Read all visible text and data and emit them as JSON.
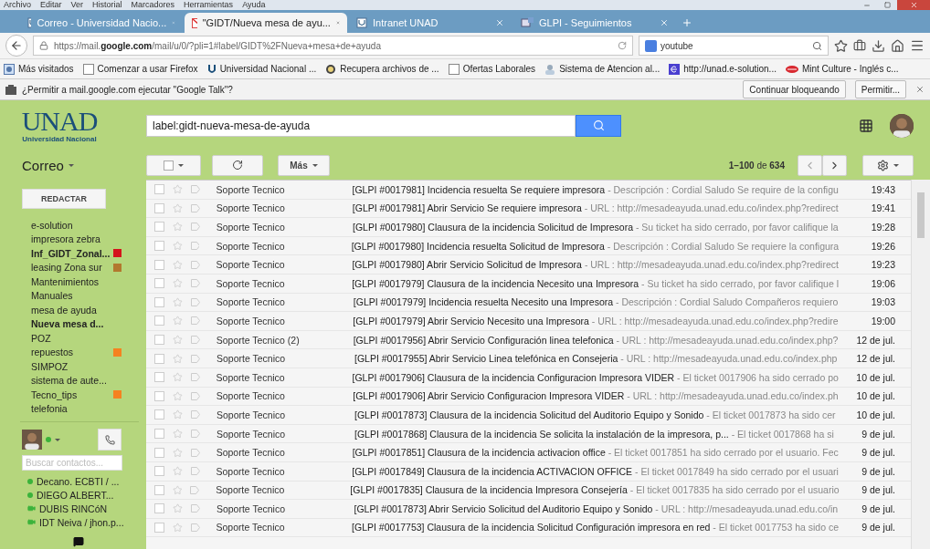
{
  "menu_bar": [
    "Archivo",
    "Editar",
    "Ver",
    "Historial",
    "Marcadores",
    "Herramientas",
    "Ayuda"
  ],
  "tabs": [
    {
      "title": "Correo - Universidad Nacio...",
      "kind": "unad",
      "selected": false
    },
    {
      "title": "\"GIDT/Nueva mesa de ayu...",
      "kind": "gmail",
      "selected": true
    },
    {
      "title": "Intranet UNAD",
      "kind": "unad",
      "selected": false
    },
    {
      "title": "GLPI - Seguimientos",
      "kind": "glpi",
      "selected": false
    }
  ],
  "address_bar": {
    "host_before": "https://mail.",
    "host": "google.com",
    "path": "/mail/u/0/?pli=1#label/GIDT%2FNueva+mesa+de+ayuda"
  },
  "search_bar": {
    "value": "youtube"
  },
  "bookmarks": [
    {
      "label": "Más visitados",
      "kind": "folder"
    },
    {
      "label": "Comenzar a usar Firefox",
      "kind": "blank"
    },
    {
      "label": "Universidad Nacional ...",
      "kind": "unad"
    },
    {
      "label": "Recupera archivos de ...",
      "kind": "badge"
    },
    {
      "label": "Ofertas Laborales",
      "kind": "blank"
    },
    {
      "label": "Sistema de Atencion al...",
      "kind": "person"
    },
    {
      "label": "http://unad.e-solution...",
      "kind": "letter"
    },
    {
      "label": "Mint Culture - Inglés c...",
      "kind": "lips"
    }
  ],
  "notification": {
    "message": "¿Permitir a mail.google.com ejecutar \"Google Talk\"?",
    "buttons": [
      "Continuar bloqueando",
      "Permitir..."
    ]
  },
  "gmail": {
    "logo": {
      "text": "UNAD",
      "caption": "Universidad Nacional"
    },
    "search": {
      "value": "label:gidt-nueva-mesa-de-ayuda"
    },
    "app_title": "Correo",
    "compose": "REDACTAR",
    "more": "Más",
    "pagination": "**1–100** de **634**",
    "labels": [
      {
        "name": "e-solution",
        "unread": false
      },
      {
        "name": "impresora zebra",
        "unread": false
      },
      {
        "name": "Inf_GIDT_Zonal...",
        "unread": true,
        "color": "#d4141c"
      },
      {
        "name": "leasing Zona sur",
        "unread": false,
        "color": "#b2782e"
      },
      {
        "name": "Mantenimientos",
        "unread": false
      },
      {
        "name": "Manuales",
        "unread": false
      },
      {
        "name": "mesa de ayuda",
        "unread": false
      },
      {
        "name": "Nueva mesa d...",
        "unread": true
      },
      {
        "name": "POZ",
        "unread": false
      },
      {
        "name": "repuestos",
        "unread": false,
        "color": "#f58220"
      },
      {
        "name": "SIMPOZ",
        "unread": false
      },
      {
        "name": "sistema de aute...",
        "unread": false
      },
      {
        "name": "Tecno_tips",
        "unread": false,
        "color": "#f58220"
      },
      {
        "name": "telefonia",
        "unread": false
      }
    ],
    "chat": {
      "search_placeholder": "Buscar contactos...",
      "contacts": [
        {
          "name": "Decano. ECBTI / ...",
          "kind": "online"
        },
        {
          "name": "DIEGO ALBERT...",
          "kind": "online"
        },
        {
          "name": "DUBIS RINCóN",
          "kind": "video"
        },
        {
          "name": "IDT Neiva / jhon.p...",
          "kind": "video"
        }
      ]
    },
    "emails": [
      {
        "checked": false,
        "starred": false,
        "sender": "Soporte Tecnico",
        "subject": "[GLPI #0017981] Incidencia resuelta Se requiere impresora",
        "snippet": "- Descripción : Cordial Saludo Se require de la configu",
        "date": "19:43"
      },
      {
        "checked": false,
        "starred": false,
        "sender": "Soporte Tecnico",
        "subject": "[GLPI #0017981] Abrir Servicio Se requiere impresora",
        "snippet": "- URL : http://mesadeayuda.unad.edu.co/index.php?redirect",
        "date": "19:41"
      },
      {
        "checked": false,
        "starred": false,
        "sender": "Soporte Tecnico",
        "subject": "[GLPI #0017980] Clausura de la incidencia Solicitud de Impresora",
        "snippet": "- Su ticket ha sido cerrado, por favor califique la",
        "date": "19:28"
      },
      {
        "checked": false,
        "starred": false,
        "sender": "Soporte Tecnico",
        "subject": "[GLPI #0017980] Incidencia resuelta Solicitud de Impresora",
        "snippet": "- Descripción : Cordial Saludo Se requiere la configura",
        "date": "19:26"
      },
      {
        "checked": false,
        "starred": false,
        "sender": "Soporte Tecnico",
        "subject": "[GLPI #0017980] Abrir Servicio Solicitud de Impresora",
        "snippet": "- URL : http://mesadeayuda.unad.edu.co/index.php?redirect",
        "date": "19:23"
      },
      {
        "checked": false,
        "starred": false,
        "sender": "Soporte Tecnico",
        "subject": "[GLPI #0017979] Clausura de la incidencia Necesito una Impresora",
        "snippet": "- Su ticket ha sido cerrado, por favor califique l",
        "date": "19:06"
      },
      {
        "checked": false,
        "starred": false,
        "sender": "Soporte Tecnico",
        "subject": "[GLPI #0017979] Incidencia resuelta Necesito una Impresora",
        "snippet": "- Descripción : Cordial Saludo Compañeros requiero",
        "date": "19:03"
      },
      {
        "checked": false,
        "starred": false,
        "sender": "Soporte Tecnico",
        "subject": "[GLPI #0017979] Abrir Servicio Necesito una Impresora",
        "snippet": "- URL : http://mesadeayuda.unad.edu.co/index.php?redire",
        "date": "19:00"
      },
      {
        "checked": false,
        "starred": false,
        "sender": "Soporte Tecnico (2)",
        "subject": "[GLPI #0017956] Abrir Servicio Configuración linea telefonica",
        "snippet": "- URL : http://mesadeayuda.unad.edu.co/index.php?",
        "date": "12 de jul."
      },
      {
        "checked": false,
        "starred": false,
        "sender": "Soporte Tecnico",
        "subject": "[GLPI #0017955] Abrir Servicio Linea telefónica en Consejeria",
        "snippet": "- URL : http://mesadeayuda.unad.edu.co/index.php",
        "date": "12 de jul."
      },
      {
        "checked": false,
        "starred": false,
        "sender": "Soporte Tecnico",
        "subject": "[GLPI #0017906] Clausura de la incidencia Configuracion Impresora VIDER",
        "snippet": "- El ticket 0017906 ha sido cerrado po",
        "date": "10 de jul."
      },
      {
        "checked": false,
        "starred": false,
        "sender": "Soporte Tecnico",
        "subject": "[GLPI #0017906] Abrir Servicio Configuracion Impresora VIDER",
        "snippet": "- URL : http://mesadeayuda.unad.edu.co/index.ph",
        "date": "10 de jul."
      },
      {
        "checked": false,
        "starred": false,
        "sender": "Soporte Tecnico",
        "subject": "[GLPI #0017873] Clausura de la incidencia Solicitud del Auditorio Equipo y Sonido",
        "snippet": "- El ticket 0017873 ha sido cer",
        "date": "10 de jul."
      },
      {
        "checked": false,
        "starred": false,
        "sender": "Soporte Tecnico",
        "subject": "[GLPI #0017868] Clausura de la incidencia Se solicita la instalación de la impresora, p...",
        "snippet": "- El ticket 0017868 ha si",
        "date": "9 de jul."
      },
      {
        "checked": false,
        "starred": false,
        "sender": "Soporte Tecnico",
        "subject": "[GLPI #0017851] Clausura de la incidencia activacion office",
        "snippet": "- El ticket 0017851 ha sido cerrado por el usuario. Fec",
        "date": "9 de jul."
      },
      {
        "checked": false,
        "starred": false,
        "sender": "Soporte Tecnico",
        "subject": "[GLPI #0017849] Clausura de la incidencia ACTIVACION OFFICE",
        "snippet": "- El ticket 0017849 ha sido cerrado por el usuari",
        "date": "9 de jul."
      },
      {
        "checked": false,
        "starred": false,
        "sender": "Soporte Tecnico",
        "subject": "[GLPI #0017835] Clausura de la incidencia Impresora Consejería",
        "snippet": "- El ticket 0017835 ha sido cerrado por el usuario",
        "date": "9 de jul."
      },
      {
        "checked": false,
        "starred": false,
        "sender": "Soporte Tecnico",
        "subject": "[GLPI #0017873] Abrir Servicio Solicitud del Auditorio Equipo y Sonido",
        "snippet": "- URL : http://mesadeayuda.unad.edu.co/in",
        "date": "9 de jul."
      },
      {
        "checked": false,
        "starred": false,
        "sender": "Soporte Tecnico",
        "subject": "[GLPI #0017753] Clausura de la incidencia Solicitud Configuración impresora en red",
        "snippet": "- El ticket 0017753 ha sido ce",
        "date": "9 de jul."
      }
    ]
  }
}
